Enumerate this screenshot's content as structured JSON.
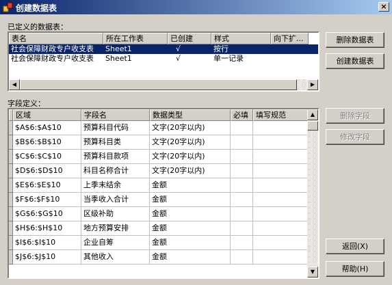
{
  "window": {
    "title": "创建数据表",
    "close_glyph": "×"
  },
  "defined_tables": {
    "label": "已定义的数据表：",
    "columns": [
      "表名",
      "所在工作表",
      "已创建",
      "样式",
      "向下扩..."
    ],
    "rows": [
      {
        "name": "社会保障财政专户收支表",
        "sheet": "Sheet1",
        "created": "√",
        "style": "按行",
        "extend": "",
        "selected": true
      },
      {
        "name": "社会保障财政专户收支表",
        "sheet": "Sheet1",
        "created": "√",
        "style": "单一记录",
        "extend": "",
        "selected": false
      }
    ]
  },
  "fields": {
    "label": "字段定义：",
    "columns": [
      "区域",
      "字段名",
      "数据类型",
      "必填",
      "填写规范"
    ],
    "rows": [
      [
        "$A$6:$A$10",
        "预算科目代码",
        "文字(20字以内)",
        "",
        ""
      ],
      [
        "$B$6:$B$10",
        "预算科目类",
        "文字(20字以内)",
        "",
        ""
      ],
      [
        "$C$6:$C$10",
        "预算科目款项",
        "文字(20字以内)",
        "",
        ""
      ],
      [
        "$D$6:$D$10",
        "科目名称合计",
        "文字(20字以内)",
        "",
        ""
      ],
      [
        "$E$6:$E$10",
        "上季末结余",
        "金额",
        "",
        ""
      ],
      [
        "$F$6:$F$10",
        "当季收入合计",
        "金额",
        "",
        ""
      ],
      [
        "$G$6:$G$10",
        "区级补助",
        "金额",
        "",
        ""
      ],
      [
        "$H$6:$H$10",
        "地方预算安排",
        "金额",
        "",
        ""
      ],
      [
        "$I$6:$I$10",
        "企业自筹",
        "金额",
        "",
        ""
      ],
      [
        "$J$6:$J$10",
        "其他收入",
        "金额",
        "",
        ""
      ]
    ]
  },
  "buttons": {
    "delete_table": "删除数据表",
    "create_table": "创建数据表",
    "delete_field": "删除字段",
    "modify_field": "修改字段",
    "back": "返回(X)",
    "help": "帮助(H)"
  }
}
